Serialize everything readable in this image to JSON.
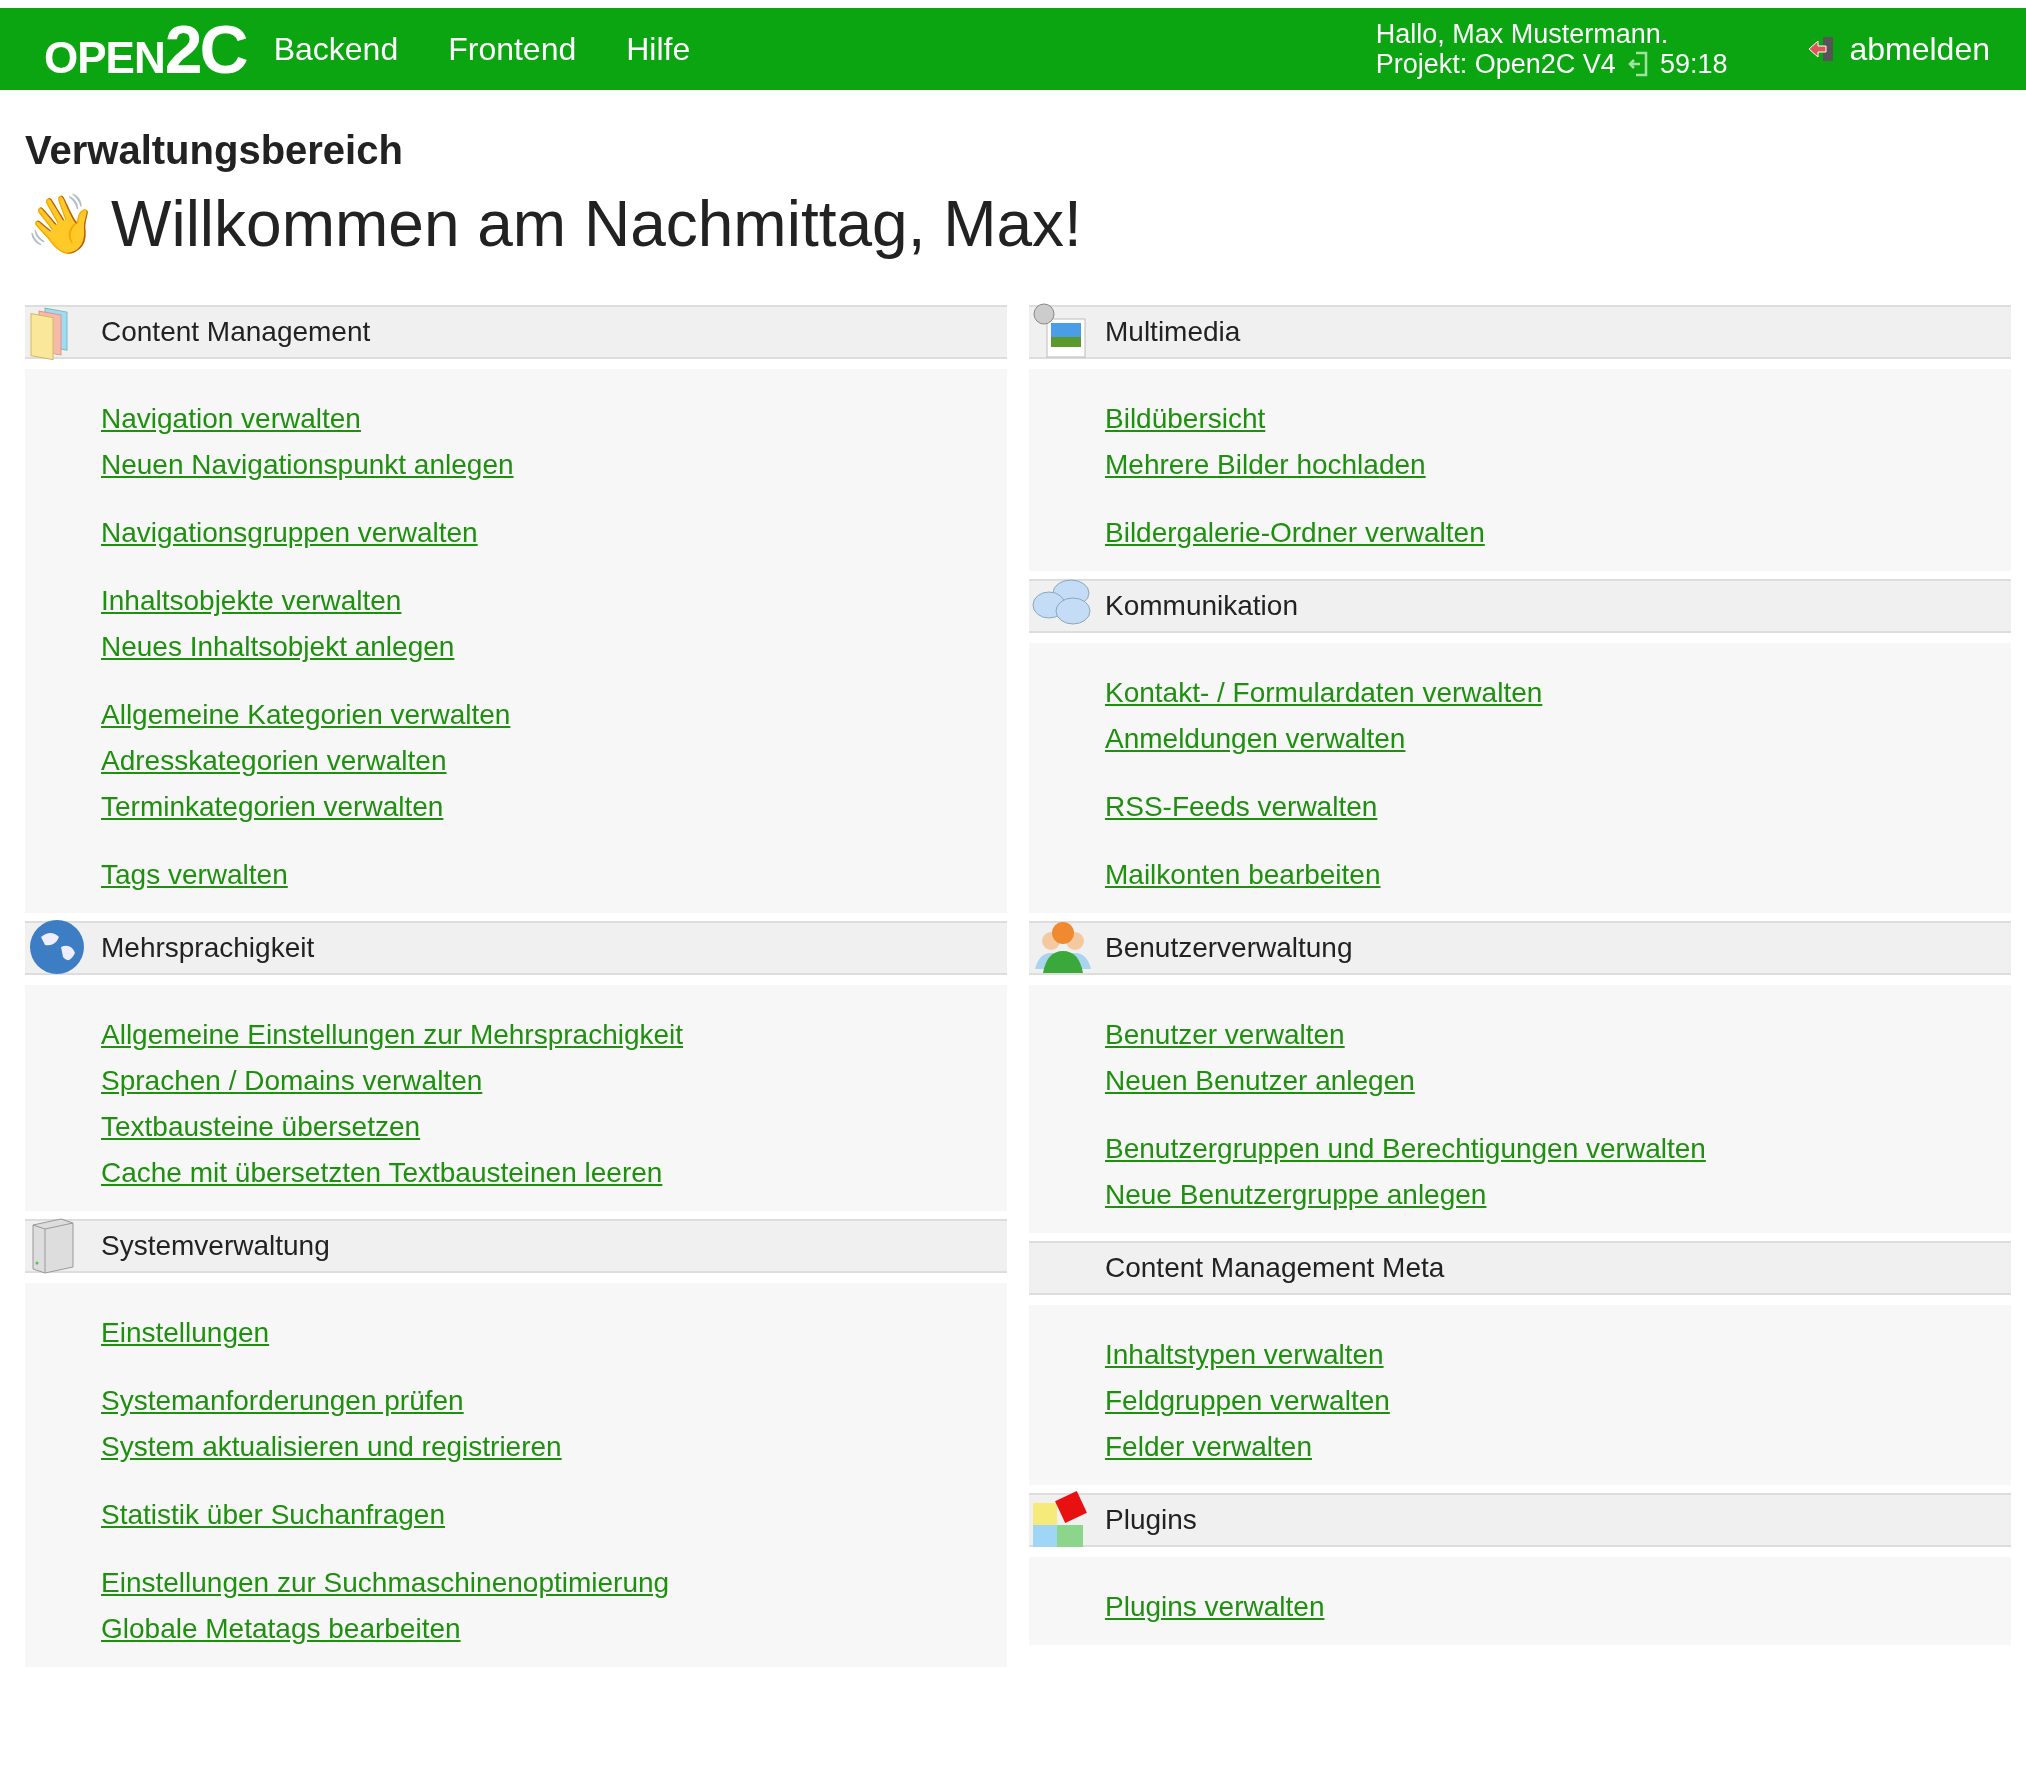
{
  "header": {
    "logo_left": "OPEN",
    "logo_right": "2C",
    "nav": [
      "Backend",
      "Frontend",
      "Hilfe"
    ],
    "greeting": "Hallo, Max Mustermann.",
    "project": "Projekt: Open2C V4",
    "timer": "59:18",
    "logout": "abmelden"
  },
  "page_title": "Verwaltungsbereich",
  "welcome": {
    "emoji": "👋",
    "text": "Willkommen am Nachmittag, Max!"
  },
  "columns": [
    [
      {
        "title": "Content Management",
        "groups": [
          [
            "Navigation verwalten",
            "Neuen Navigationspunkt anlegen"
          ],
          [
            "Navigationsgruppen verwalten"
          ],
          [
            "Inhaltsobjekte verwalten",
            "Neues Inhaltsobjekt anlegen"
          ],
          [
            "Allgemeine Kategorien verwalten",
            "Adresskategorien verwalten",
            "Terminkategorien verwalten"
          ],
          [
            "Tags verwalten"
          ]
        ]
      },
      {
        "title": "Mehrsprachigkeit",
        "groups": [
          [
            "Allgemeine Einstellungen zur Mehrsprachigkeit",
            "Sprachen / Domains verwalten",
            "Textbausteine übersetzen",
            "Cache mit übersetzten Textbausteinen leeren"
          ]
        ]
      },
      {
        "title": "Systemverwaltung",
        "groups": [
          [
            "Einstellungen"
          ],
          [
            "Systemanforderungen prüfen",
            "System aktualisieren und registrieren"
          ],
          [
            "Statistik über Suchanfragen"
          ],
          [
            "Einstellungen zur Suchmaschinenoptimierung",
            "Globale Metatags bearbeiten"
          ]
        ]
      }
    ],
    [
      {
        "title": "Multimedia",
        "groups": [
          [
            "Bildübersicht",
            "Mehrere Bilder hochladen"
          ],
          [
            "Bildergalerie-Ordner verwalten"
          ]
        ]
      },
      {
        "title": "Kommunikation",
        "groups": [
          [
            "Kontakt- / Formulardaten verwalten",
            "Anmeldungen verwalten"
          ],
          [
            "RSS-Feeds verwalten"
          ],
          [
            "Mailkonten bearbeiten"
          ]
        ]
      },
      {
        "title": "Benutzerverwaltung",
        "groups": [
          [
            "Benutzer verwalten",
            "Neuen Benutzer anlegen"
          ],
          [
            "Benutzergruppen und Berechtigungen verwalten",
            "Neue Benutzergruppe anlegen"
          ]
        ]
      },
      {
        "title": "Content Management Meta",
        "groups": [
          [
            "Inhaltstypen verwalten",
            "Feldgruppen verwalten",
            "Felder verwalten"
          ]
        ]
      },
      {
        "title": "Plugins",
        "groups": [
          [
            "Plugins verwalten"
          ]
        ]
      }
    ]
  ]
}
